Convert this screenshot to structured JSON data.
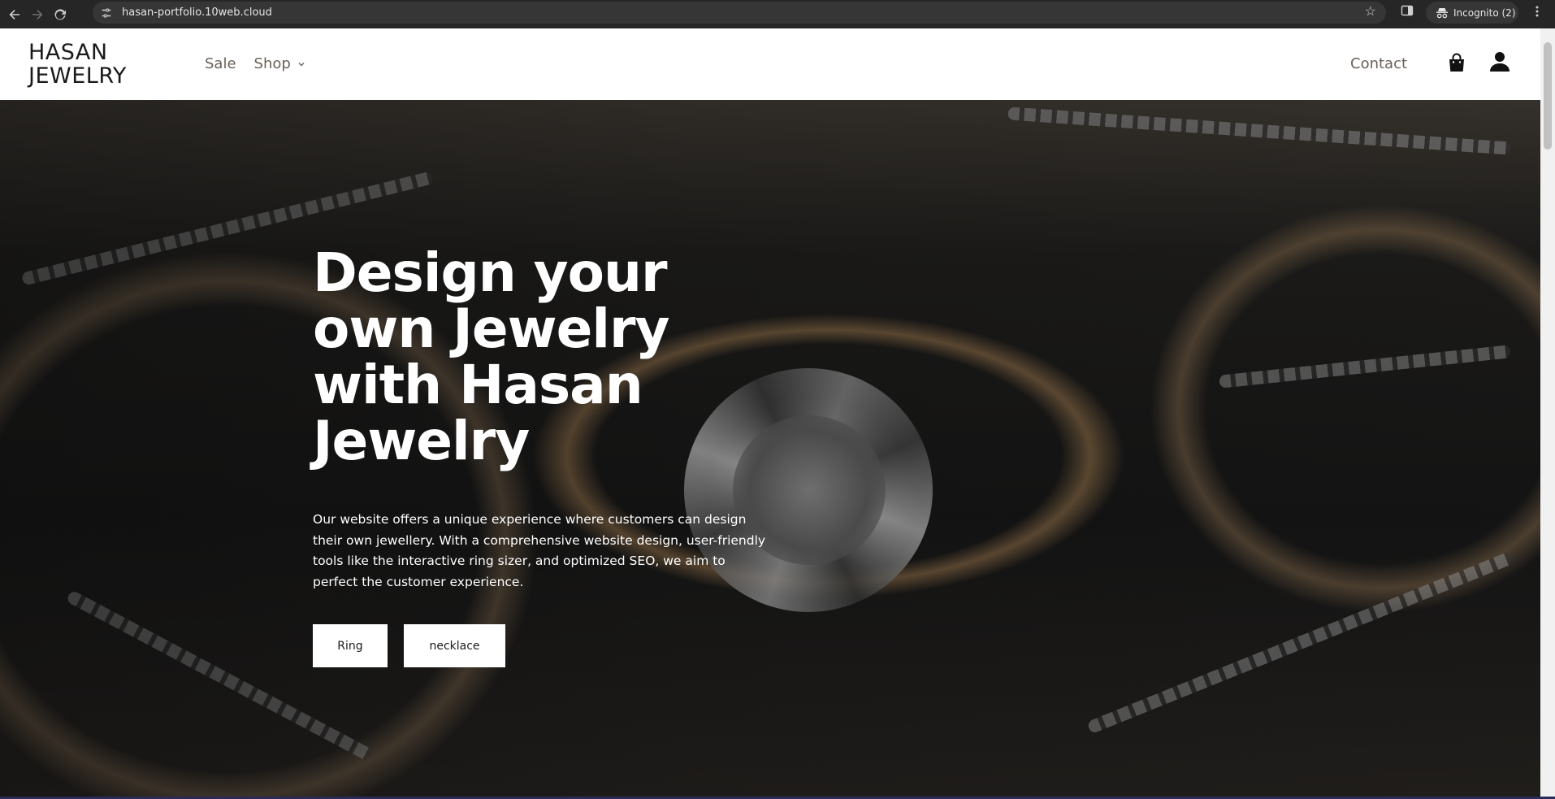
{
  "browser": {
    "url": "hasan-portfolio.10web.cloud",
    "incognito_label": "Incognito (2)",
    "icons": [
      "back-arrow-icon",
      "forward-arrow-icon",
      "reload-icon",
      "site-settings-icon",
      "star-icon",
      "side-panel-icon",
      "incognito-icon",
      "kebab-menu-icon"
    ]
  },
  "header": {
    "logo_line1": "HASAN",
    "logo_line2": "JEWELRY",
    "nav": [
      {
        "label": "Sale"
      },
      {
        "label": "Shop"
      }
    ],
    "contact_label": "Contact",
    "icons": [
      "shopping-bag-icon",
      "user-icon"
    ]
  },
  "hero": {
    "title": "Design your own Jewelry with Hasan Jewelry",
    "description": "Our website offers a unique experience where customers can design their own jewellery. With a comprehensive website design, user-friendly tools like the interactive ring sizer, and optimized SEO, we aim to perfect the customer experience.",
    "buttons": [
      {
        "label": "Ring"
      },
      {
        "label": "necklace"
      }
    ]
  },
  "colors": {
    "chrome_bg": "#262626",
    "header_bg": "#ffffff",
    "nav_text": "#6a6158",
    "hero_text": "#ffffff",
    "button_bg": "#ffffff"
  }
}
